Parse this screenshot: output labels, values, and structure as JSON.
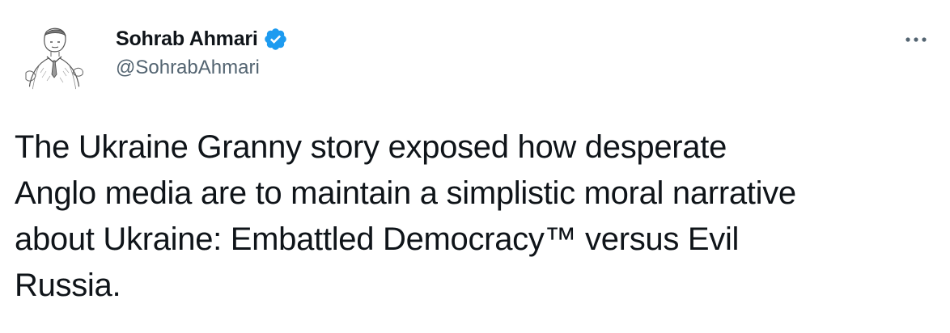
{
  "author": {
    "display_name": "Sohrab Ahmari",
    "handle": "@SohrabAhmari",
    "verified_icon": "verified-badge-icon",
    "verified_color": "#1d9bf0",
    "avatar_icon": "avatar-sketch-portrait"
  },
  "menu": {
    "more_icon": "more-options-icon"
  },
  "tweet": {
    "text": "The Ukraine Granny story exposed how desperate\nAnglo media are to maintain a simplistic moral narrative\nabout Ukraine: Embattled Democracy™ versus Evil\nRussia."
  },
  "colors": {
    "text_primary": "#0f1419",
    "text_secondary": "#536471",
    "background": "#ffffff"
  }
}
